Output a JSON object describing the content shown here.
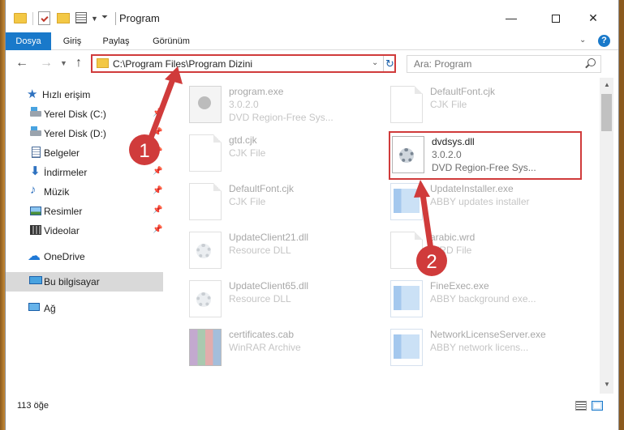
{
  "window": {
    "title": "Program"
  },
  "ribbon": {
    "tabs": [
      "Dosya",
      "Giriş",
      "Paylaş",
      "Görünüm"
    ]
  },
  "address": {
    "path": "C:\\Program Files\\Program Dizini"
  },
  "search": {
    "placeholder": "Ara: Program"
  },
  "sidebar": {
    "items": [
      {
        "label": "Hızlı erişim",
        "icon": "star-icon"
      },
      {
        "label": "Yerel Disk (C:)",
        "icon": "drive-icon",
        "pinned": true
      },
      {
        "label": "Yerel Disk (D:)",
        "icon": "drive-icon",
        "pinned": true
      },
      {
        "label": "Belgeler",
        "icon": "document-icon",
        "pinned": true
      },
      {
        "label": "İndirmeler",
        "icon": "download-icon",
        "pinned": true
      },
      {
        "label": "Müzik",
        "icon": "music-icon",
        "pinned": true
      },
      {
        "label": "Resimler",
        "icon": "pictures-icon",
        "pinned": true
      },
      {
        "label": "Videolar",
        "icon": "video-icon",
        "pinned": true
      },
      {
        "label": "OneDrive",
        "icon": "cloud-icon"
      },
      {
        "label": "Bu bilgisayar",
        "icon": "computer-icon",
        "selected": true
      },
      {
        "label": "Ağ",
        "icon": "network-icon"
      }
    ]
  },
  "files": [
    {
      "name": "program.exe",
      "line2": "3.0.2.0",
      "line3": "DVD Region-Free Sys...",
      "icon": "program-icon"
    },
    {
      "name": "DefaultFont.cjk",
      "line2": "CJK File",
      "line3": "",
      "icon": "blank-file-icon"
    },
    {
      "name": "gtd.cjk",
      "line2": "CJK File",
      "line3": "",
      "icon": "blank-file-icon"
    },
    {
      "name": "dvdsys.dll",
      "line2": "3.0.2.0",
      "line3": "DVD Region-Free Sys...",
      "icon": "dll-icon"
    },
    {
      "name": "DefaultFont.cjk",
      "line2": "CJK File",
      "line3": "",
      "icon": "blank-file-icon"
    },
    {
      "name": "UpdateInstaller.exe",
      "line2": "ABBY updates installer",
      "line3": "",
      "icon": "installer-icon"
    },
    {
      "name": "UpdateClient21.dll",
      "line2": "Resource DLL",
      "line3": "",
      "icon": "dll-icon"
    },
    {
      "name": "arabic.wrd",
      "line2": "WRD File",
      "line3": "",
      "icon": "blank-file-icon"
    },
    {
      "name": "UpdateClient65.dll",
      "line2": "Resource DLL",
      "line3": "",
      "icon": "dll-icon"
    },
    {
      "name": "FineExec.exe",
      "line2": "ABBY background exe...",
      "line3": "",
      "icon": "app-icon"
    },
    {
      "name": "certificates.cab",
      "line2": "WinRAR Archive",
      "line3": "",
      "icon": "archive-icon"
    },
    {
      "name": "NetworkLicenseServer.exe",
      "line2": "ABBY network licens...",
      "line3": "",
      "icon": "app-icon"
    }
  ],
  "status": {
    "count": "113 öğe"
  },
  "annotations": {
    "marker1": "1",
    "marker2": "2"
  },
  "colors": {
    "accent": "#1979ca",
    "highlight": "#d03b3b"
  }
}
